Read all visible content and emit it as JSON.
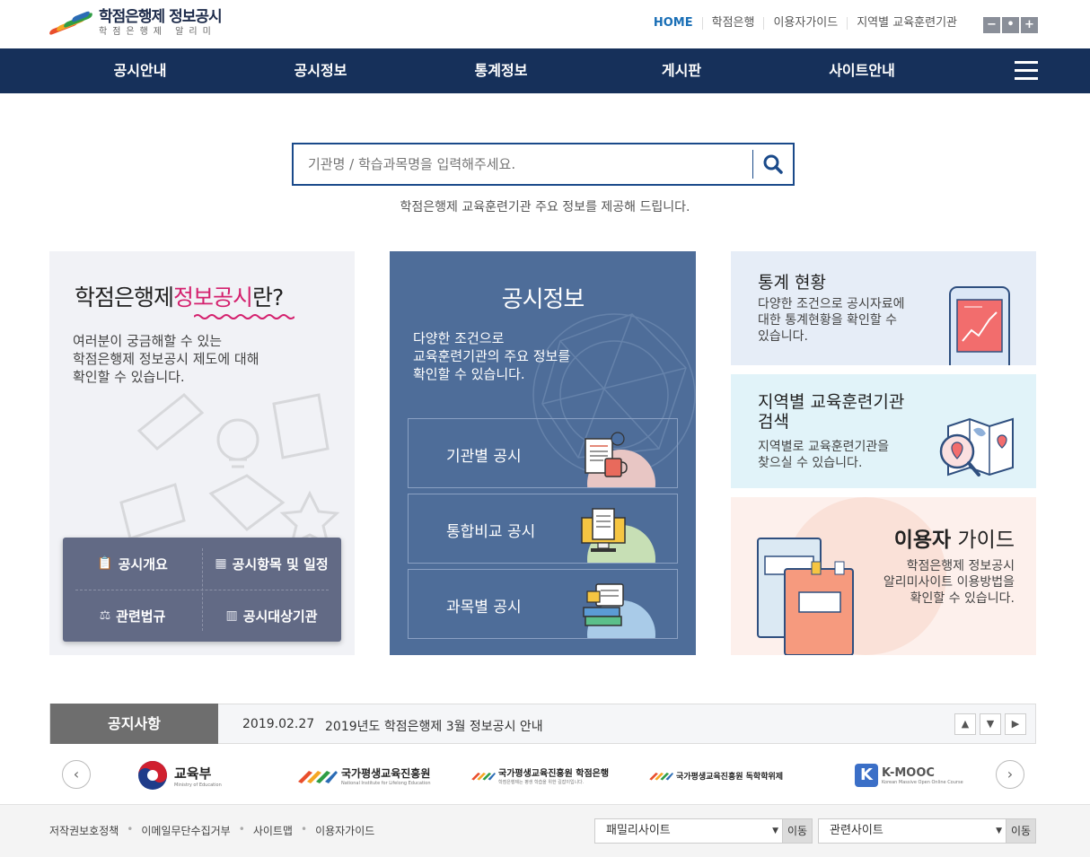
{
  "header": {
    "logo_title": "학점은행제 정보공시",
    "logo_sub": "학점은행제 알리미",
    "util_links": [
      "HOME",
      "학점은행",
      "이용자가이드",
      "지역별 교육훈련기관"
    ],
    "zoom": [
      "−",
      "•",
      "+"
    ]
  },
  "gnb": {
    "items": [
      "공시안내",
      "공시정보",
      "통계정보",
      "게시판",
      "사이트안내"
    ]
  },
  "search": {
    "placeholder": "기관명 / 학습과목명을 입력해주세요.",
    "desc": "학점은행제 교육훈련기관 주요 정보를 제공해 드립니다."
  },
  "info_panel": {
    "title_pre": "학점은행제",
    "title_hl": "정보공시",
    "title_post": "란?",
    "desc": [
      "여러분이 궁금해할 수 있는",
      "학점은행제 정보공시 제도에 대해",
      "확인할 수 있습니다."
    ],
    "quick": [
      "공시개요",
      "공시항목 및 일정",
      "관련법규",
      "공시대상기관"
    ]
  },
  "gongsi_panel": {
    "title": "공시정보",
    "desc": [
      "다양한 조건으로",
      "교육훈련기관의 주요 정보를",
      "확인할 수 있습니다."
    ],
    "items": [
      "기관별 공시",
      "통합비교 공시",
      "과목별 공시"
    ]
  },
  "cards": {
    "stats": {
      "title": "통계 현황",
      "desc": [
        "다양한 조건으로 공시자료에",
        "대한 통계현황을 확인할 수",
        "있습니다."
      ]
    },
    "region": {
      "title": [
        "지역별 교육훈련기관",
        "검색"
      ],
      "desc": [
        "지역별로 교육훈련기관을",
        "찾으실 수 있습니다."
      ]
    },
    "guide": {
      "title_bold": "이용자",
      "title_rest": " 가이드",
      "desc": [
        "학점은행제 정보공시",
        "알리미사이트 이용방법을",
        "확인할 수 있습니다."
      ]
    }
  },
  "notice": {
    "label": "공지사항",
    "date": "2019.02.27",
    "text": "2019년도 학점은행제 3월 정보공시 안내",
    "controls": [
      "▲",
      "▼",
      "▶"
    ]
  },
  "partners": {
    "moe": {
      "name": "교육부",
      "sub": "Ministry of Education"
    },
    "nile": {
      "name": "국가평생교육진흥원",
      "sub": "National Institute for Lifelong Education"
    },
    "cb": {
      "name": "국가평생교육진흥원 학점은행",
      "sub": "학점은행제는 평생 학습을 위한 길잡이입니다."
    },
    "bsd": {
      "name": "국가평생교육진흥원 독학학위제"
    },
    "kmooc": {
      "name": "K-MOOC",
      "sub": "Korean Massive Open Online Course"
    }
  },
  "footer": {
    "links": [
      "저작권보호정책",
      "이메일무단수집거부",
      "사이트맵",
      "이용자가이드"
    ],
    "family_select": "패밀리사이트",
    "related_select": "관련사이트",
    "go_label": "이동"
  },
  "colors": {
    "navy": "#16305a",
    "accent_pink": "#d4216e",
    "gongsi_blue": "#4e6d99",
    "quick_gray": "#626a85"
  }
}
